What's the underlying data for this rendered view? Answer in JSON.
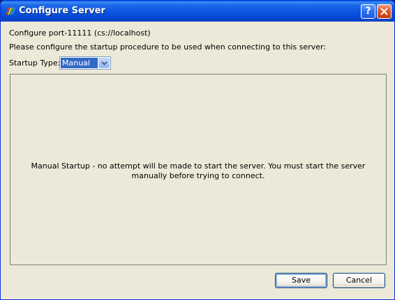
{
  "window": {
    "title": "Configure Server",
    "help_glyph": "?",
    "icons": {
      "app": "app-logo-icon",
      "help": "help-icon",
      "close": "close-icon"
    }
  },
  "content": {
    "server_line": "Configure port-11111 (cs://localhost)",
    "instruction": "Please configure the startup procedure to be used when connecting to this server:",
    "startup_type": {
      "label": "Startup Type:",
      "selected": "Manual",
      "arrow_icon": "chevron-down-icon"
    },
    "panel_message": "Manual Startup - no attempt will be made to start the server.  You must start the server manually before trying to connect."
  },
  "buttons": {
    "save": "Save",
    "cancel": "Cancel"
  },
  "colors": {
    "titlebar": "#0a54de",
    "dialog_bg": "#ece9d8",
    "selection": "#316ac5",
    "close_button": "#e0542a"
  }
}
